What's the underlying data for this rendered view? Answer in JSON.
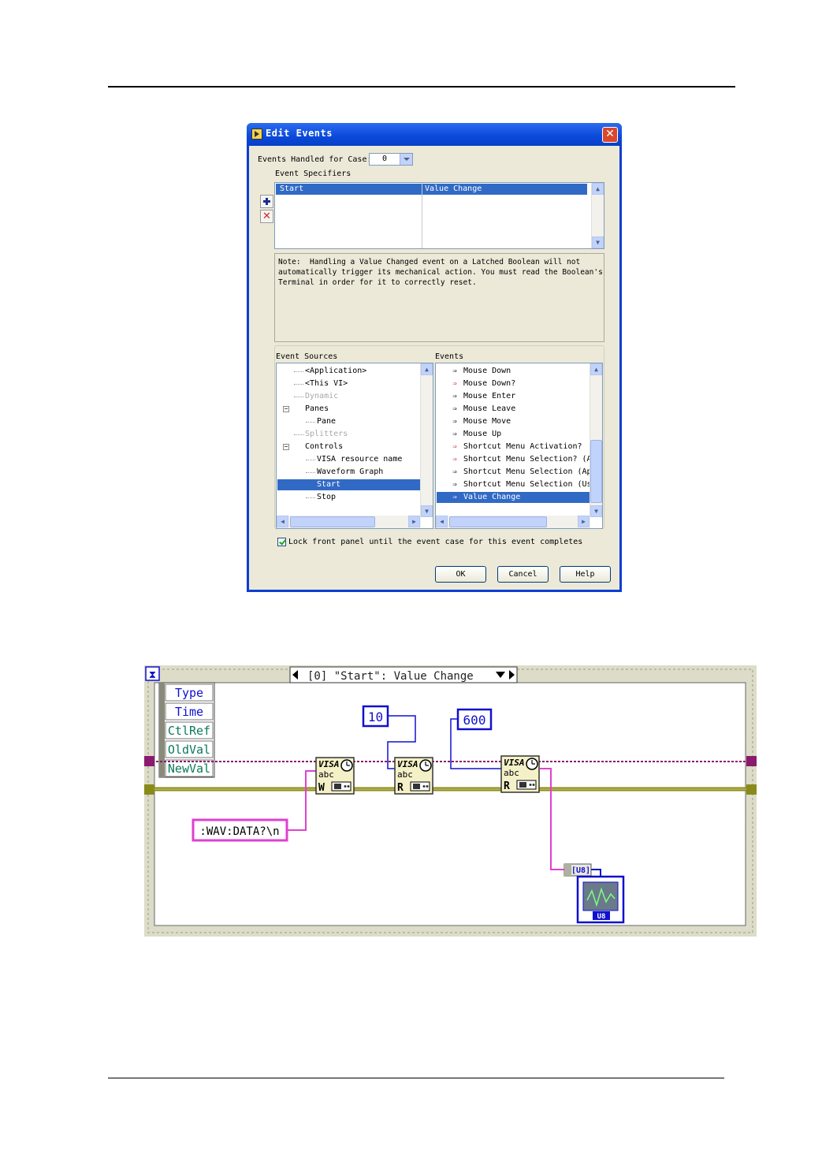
{
  "dialog": {
    "title": "Edit Events",
    "close_glyph": "✕",
    "events_handled_label": "Events Handled for Case:",
    "events_handled_value": "0",
    "event_specifiers_label": "Event Specifiers",
    "specifier": {
      "source": "Start",
      "event": "Value Change"
    },
    "note": "Note:  Handling a Value Changed event on a Latched Boolean will not\nautomatically trigger its mechanical action. You must read the Boolean's\nTerminal in order for it to correctly reset.",
    "event_sources_label": "Event Sources",
    "events_label": "Events",
    "event_sources": [
      {
        "label": "<Application>",
        "indent": 1,
        "dim": false
      },
      {
        "label": "<This VI>",
        "indent": 1,
        "dim": false
      },
      {
        "label": "Dynamic",
        "indent": 1,
        "dim": true
      },
      {
        "label": "Panes",
        "indent": 1,
        "dim": false,
        "expander": "−"
      },
      {
        "label": "Pane",
        "indent": 2,
        "dim": false
      },
      {
        "label": "Splitters",
        "indent": 1,
        "dim": true
      },
      {
        "label": "Controls",
        "indent": 1,
        "dim": false,
        "expander": "−"
      },
      {
        "label": "VISA resource name",
        "indent": 2,
        "dim": false
      },
      {
        "label": "Waveform Graph",
        "indent": 2,
        "dim": false
      },
      {
        "label": "Start",
        "indent": 2,
        "dim": false,
        "selected": true
      },
      {
        "label": "Stop",
        "indent": 2,
        "dim": false
      }
    ],
    "events": [
      {
        "label": "Mouse Down",
        "filter": false
      },
      {
        "label": "Mouse Down?",
        "filter": true
      },
      {
        "label": "Mouse Enter",
        "filter": false
      },
      {
        "label": "Mouse Leave",
        "filter": false
      },
      {
        "label": "Mouse Move",
        "filter": false
      },
      {
        "label": "Mouse Up",
        "filter": false
      },
      {
        "label": "Shortcut Menu Activation?",
        "filter": true
      },
      {
        "label": "Shortcut Menu Selection? (Ap",
        "filter": true
      },
      {
        "label": "Shortcut Menu Selection (App",
        "filter": false
      },
      {
        "label": "Shortcut Menu Selection (Use",
        "filter": false
      },
      {
        "label": "Value Change",
        "filter": false,
        "selected": true
      }
    ],
    "lock_label": "Lock front panel until the event case for this event completes",
    "lock_checked": true,
    "buttons": {
      "ok": "OK",
      "cancel": "Cancel",
      "help": "Help"
    }
  },
  "block_diagram": {
    "case_selector": "[0] \"Start\": Value Change",
    "event_data_node": [
      "Type",
      "Time",
      "CtlRef",
      "OldVal",
      "NewVal"
    ],
    "constants": {
      "timeout": "10",
      "byte_count": "600",
      "command": ":WAV:DATA?\\n"
    },
    "visa_label": "VISA",
    "visa_sub": "abc",
    "write_letter": "W",
    "read_letter": "R",
    "convert_label": "[U8]",
    "graph_label": "U8"
  },
  "colors": {
    "titlebar": "#0a49d9",
    "selection": "#316ac5",
    "dialog_face": "#ece9d8",
    "refnum_wire": "#8a1a6e",
    "error_wire": "#8a8a1a",
    "string_wire": "#e040d0",
    "numeric_blue": "#1010d0"
  }
}
